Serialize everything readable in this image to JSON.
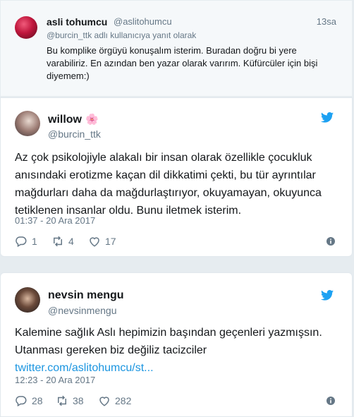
{
  "reply_tweet": {
    "name": "asli tohumcu",
    "handle": "@aslitohumcu",
    "time": "13sa",
    "replying_to": "@burcin_ttk adlı kullanıcıya yanıt olarak",
    "text": "Bu komplike örgüyü konuşalım isterim. Buradan doğru bi yere varabiliriz. En azından ben yazar olarak varırım. Küfürcüler için bişi diyemem:)"
  },
  "tweet_1": {
    "name": "willow",
    "name_emoji": "🌸",
    "handle": "@burcin_ttk",
    "text": "Az çok psikolojiyle alakalı bir insan olarak özellikle çocukluk anısındaki erotizme kaçan dil dikkatimi çekti, bu tür ayrıntılar mağdurları daha da mağdurlaştırıyor, okuyamayan, okuyunca tetiklenen insanlar oldu. Bunu iletmek isterim.",
    "timestamp": "01:37 - 20 Ara 2017",
    "replies": "1",
    "retweets": "4",
    "likes": "17"
  },
  "tweet_2": {
    "name": "nevsin mengu",
    "handle": "@nevsinmengu",
    "text": "Kalemine sağlık Aslı hepimizin başından geçenleri yazmışsın. Utanması gereken biz değiliz tacizciler",
    "link": "twitter.com/aslitohumcu/st...",
    "timestamp": "12:23 - 20 Ara 2017",
    "replies": "28",
    "retweets": "38",
    "likes": "282"
  },
  "colors": {
    "brand_blue": "#1da1f2",
    "link_blue": "#1b95e0",
    "muted_gray": "#657786",
    "background": "#e6ecf0"
  },
  "icons": [
    "reply-icon",
    "retweet-icon",
    "like-icon",
    "info-icon",
    "twitter-bird-icon"
  ]
}
